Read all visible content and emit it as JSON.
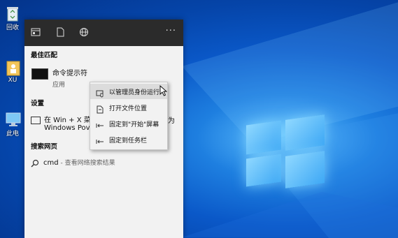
{
  "colors": {
    "desktop_blue": "#0a58c8",
    "panel_bg": "#f2f2f2",
    "topbar_bg": "#2b2b2b",
    "menu_highlight": "#dcdcdc"
  },
  "desktop": {
    "icons": [
      {
        "label": "回收",
        "icon": "recycle-bin-icon"
      },
      {
        "label": "XU",
        "icon": "user-folder-icon"
      },
      {
        "label": "此电",
        "icon": "this-pc-icon"
      }
    ]
  },
  "topbar": {
    "icons": [
      "apps-icon",
      "document-icon",
      "web-icon"
    ],
    "more": "···"
  },
  "best_match": {
    "title": "最佳匹配",
    "app_name": "命令提示符",
    "app_type": "应用"
  },
  "settings": {
    "title": "设置",
    "line1": "在 Win + X 菜",
    "line1_tail": "为",
    "line2": "Windows Pov"
  },
  "web": {
    "title": "搜索网页",
    "query": "cmd",
    "suffix": " - 查看网络搜索结果"
  },
  "context_menu": {
    "items": [
      {
        "label": "以管理员身份运行",
        "icon": "run-as-admin-icon",
        "highlighted": true
      },
      {
        "label": "打开文件位置",
        "icon": "open-location-icon",
        "highlighted": false
      },
      {
        "label": "固定到\"开始\"屏幕",
        "icon": "pin-start-icon",
        "highlighted": false
      },
      {
        "label": "固定到任务栏",
        "icon": "pin-taskbar-icon",
        "highlighted": false
      }
    ]
  }
}
